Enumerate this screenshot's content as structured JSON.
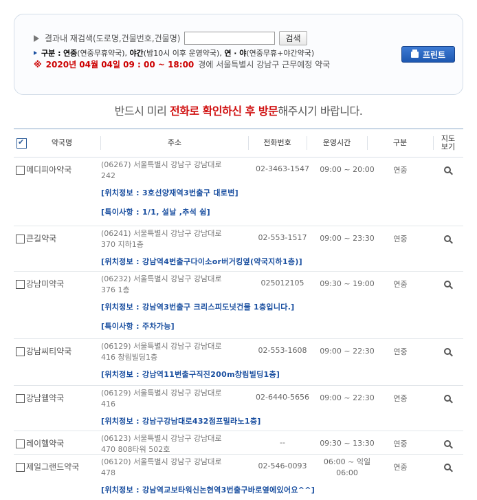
{
  "search": {
    "label": "결과내 재검색(도로명,건물번호,건물명)",
    "value": "",
    "button": "검색"
  },
  "legend": {
    "prefix": "구분 :",
    "yeonjung": "연중",
    "yeonjung_desc": "(연중무휴약국),",
    "yagan": "야간",
    "yagan_desc": "(밤10시 이후 운영약국),",
    "yeonya": "연 · 야",
    "yeonya_desc": "(연중무휴+야간약국)"
  },
  "date_line": {
    "mark": "※",
    "date": "2020년 04월 04일 09 : 00 ~ 18:00",
    "rest": "경에 서울특별시 강남구 근무예정 약국"
  },
  "print_button": "프린트",
  "notice": {
    "pre": "반드시 미리 ",
    "emph": "전화로 확인하신 후 방문",
    "post": "해주시기 바랍니다."
  },
  "table": {
    "headers": {
      "name": "약국명",
      "addr": "주소",
      "tel": "전화번호",
      "hours": "운영시간",
      "type": "구분",
      "map": "지도\n보기"
    },
    "rows": [
      {
        "name": "메디피아약국",
        "addr1": "(06267) 서울특별시 강남구 강남대로",
        "addr2": "242",
        "tel": "02-3463-1547",
        "hours1": "09:00 ~ 20:00",
        "hours2": "",
        "type": "연중",
        "info": [
          "[위치정보 : 3호선양재역3번출구 대로변]",
          "[특이사항 : 1/1, 설날 ,추석 쉼]"
        ]
      },
      {
        "name": "큰길약국",
        "addr1": "(06241) 서울특별시 강남구 강남대로",
        "addr2": "370 지하1층",
        "tel": "02-553-1517",
        "hours1": "09:00 ~ 23:30",
        "hours2": "",
        "type": "연중",
        "info": [
          "[위치정보 : 강남역4번출구다이소or버거킹옆(약국지하1층)]"
        ]
      },
      {
        "name": "강남미약국",
        "addr1": "(06232) 서울특별시 강남구 강남대로",
        "addr2": "376 1층",
        "tel": "025012105",
        "hours1": "09:30 ~ 19:00",
        "hours2": "",
        "type": "연중",
        "info": [
          "[위치정보 : 강남역3번출구 크리스피도넛건물 1층입니다.]",
          "[특이사항 : 주차가능]"
        ]
      },
      {
        "name": "강남씨티약국",
        "addr1": "(06129) 서울특별시 강남구 강남대로",
        "addr2": "416 창림빌딩1층",
        "tel": "02-553-1608",
        "hours1": "09:00 ~ 22:30",
        "hours2": "",
        "type": "연중",
        "info": [
          "[위치정보 : 강남역11번출구직진200m창림빌딩1층]"
        ]
      },
      {
        "name": "강남웰약국",
        "addr1": "(06129) 서울특별시 강남구 강남대로",
        "addr2": "416",
        "tel": "02-6440-5656",
        "hours1": "09:00 ~ 22:30",
        "hours2": "",
        "type": "연중",
        "info": [
          "[위치정보 : 강남구강남대로432점프밀라노1층]"
        ]
      },
      {
        "name": "레이헬약국",
        "addr1": "(06123) 서울특별시 강남구 강남대로",
        "addr2": "470 808타워 502호",
        "tel": "--",
        "hours1": "09:30 ~ 13:30",
        "hours2": "",
        "type": "연중",
        "info": []
      },
      {
        "name": "제일그랜드약국",
        "addr1": "(06120) 서울특별시 강남구 강남대로",
        "addr2": "478",
        "tel": "02-546-0093",
        "hours1": "06:00 ~ 익일",
        "hours2": "06:00",
        "type": "연중",
        "info": [
          "[위치정보 : 강남역교보타워신논현역3번출구바로옆에있어요^^]"
        ]
      }
    ]
  }
}
